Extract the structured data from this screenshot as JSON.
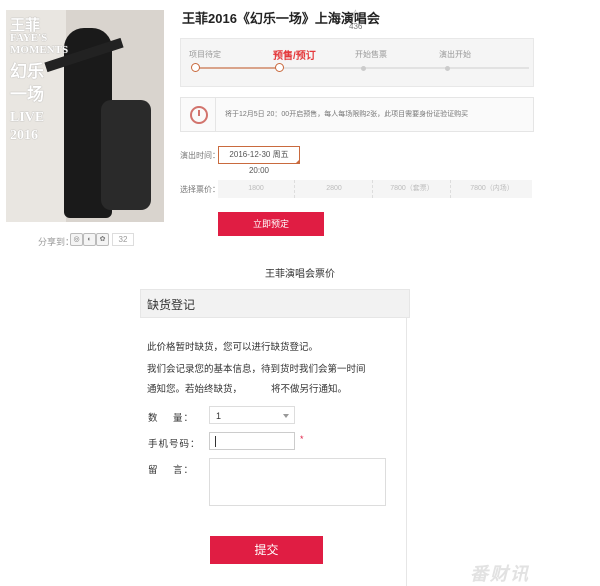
{
  "poster": {
    "artist": "王菲",
    "line1": "FAYE'S",
    "line2": "MOMENTS",
    "line3": "幻乐",
    "line4": "一场",
    "line5": "LIVE",
    "year": "2016"
  },
  "share": {
    "label": "分享到：",
    "count": "32"
  },
  "event": {
    "title": "王菲2016《幻乐一场》上海演唱会",
    "fav_count": "436"
  },
  "progress": {
    "steps": [
      "项目待定",
      "预售/预订",
      "开始售票",
      "演出开始"
    ],
    "active_index": 1
  },
  "notice": {
    "text": "将于12月5日 20：00开启预售，每人每场限购2张，此项目需要身份证验证购买"
  },
  "show_time": {
    "label": "演出时间：",
    "value": "2016-12-30 周五 20:00"
  },
  "price": {
    "label": "选择票价：",
    "options": [
      "1800",
      "2800",
      "7800（套票）",
      "7800（内场）"
    ]
  },
  "book_button": "立即预定",
  "section_title": "王菲演唱会票价",
  "modal": {
    "title": "缺货登记",
    "line1": "此价格暂时缺货，您可以进行缺货登记。",
    "line2": "我们会记录您的基本信息，待到货时我们会第一时间",
    "line3": "通知您。若始终缺货，           将不做另行通知。",
    "qty_label": "数    量：",
    "qty_value": "1",
    "phone_label": "手机号码：",
    "required_mark": "*",
    "msg_label": "留    言：",
    "submit": "提交"
  },
  "watermark": "番财讯",
  "colors": {
    "accent": "#e01d43",
    "step_active": "#e4393c"
  }
}
